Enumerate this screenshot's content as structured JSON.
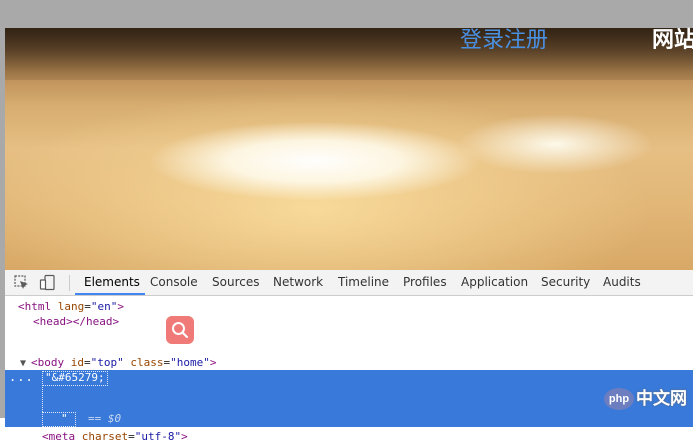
{
  "page": {
    "nav_login": "登录注册",
    "nav_site": "网站"
  },
  "devtools": {
    "tabs": [
      "Elements",
      "Console",
      "Sources",
      "Network",
      "Timeline",
      "Profiles",
      "Application",
      "Security",
      "Audits"
    ],
    "active_tab": "Elements",
    "icons": [
      "inspect-element-icon",
      "device-mode-icon"
    ],
    "accent_color": "#4285f4",
    "selection_color": "#3879d9"
  },
  "code": {
    "html_tag": "<html",
    "html_attr": "lang",
    "html_val": "\"en\"",
    "html_close": ">",
    "head_line": "<head></head>",
    "body_tag": "<body",
    "body_attr1": "id",
    "body_val1": "\"top\"",
    "body_attr2": "class",
    "body_val2": "\"home\"",
    "body_close": ">",
    "selected_text": "\"&#65279;",
    "selected_quote": "\"",
    "selected_eq": "== $0",
    "meta_tag": "<meta",
    "meta_attr": "charset",
    "meta_val": "\"utf-8\"",
    "meta_close": ">",
    "ellipsis": "..."
  },
  "overlay": {
    "search_icon": "search-icon",
    "search_color": "#f07a78"
  },
  "watermark": {
    "logo": "php",
    "text": "中文网"
  }
}
